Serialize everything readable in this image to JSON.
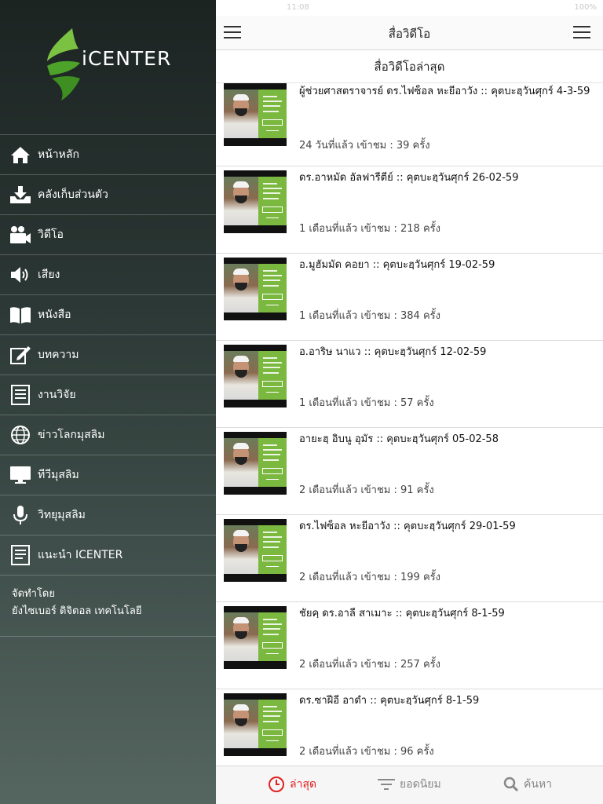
{
  "status": {
    "clock": "11:08",
    "battery": "100%"
  },
  "sidebar": {
    "logo_text": "iCENTER",
    "items": [
      {
        "label": "หน้าหลัก",
        "icon": "home-icon"
      },
      {
        "label": "คลังเก็บส่วนตัว",
        "icon": "download-tray-icon"
      },
      {
        "label": "วิดีโอ",
        "icon": "video-camera-icon"
      },
      {
        "label": "เสียง",
        "icon": "speaker-icon"
      },
      {
        "label": "หนังสือ",
        "icon": "book-icon"
      },
      {
        "label": "บทความ",
        "icon": "edit-note-icon"
      },
      {
        "label": "งานวิจัย",
        "icon": "document-list-icon"
      },
      {
        "label": "ข่าวโลกมุสลิม",
        "icon": "globe-icon"
      },
      {
        "label": "ทีวีมุสลิม",
        "icon": "monitor-icon"
      },
      {
        "label": "วิทยุมุสลิม",
        "icon": "microphone-icon"
      },
      {
        "label": "แนะนำ ICENTER",
        "icon": "document-icon"
      }
    ],
    "credit_line1": "จัดทำโดย",
    "credit_line2": "ยังไซเบอร์ ดิจิตอล เทคโนโลยี"
  },
  "nav": {
    "title": "สื่อวิดีโอ"
  },
  "subheader": "สื่อวิดีโอล่าสุด",
  "videos": [
    {
      "title": "ผู้ช่วยศาสตราจารย์ ดร.ไฟซ็อล หะยีอาวัง :: คุตบะฮฺวันศุกร์ 4-3-59",
      "meta": "24 วันที่แล้ว เข้าชม : 39 ครั้ง"
    },
    {
      "title": "ดร.อาหมัด อัลฟารีตีย์ :: คุตบะฮฺวันศุกร์ 26-02-59",
      "meta": "1 เดือนที่แล้ว เข้าชม : 218 ครั้ง"
    },
    {
      "title": "อ.มูฮัมมัด คอยา :: คุตบะฮฺวันศุกร์ 19-02-59",
      "meta": "1 เดือนที่แล้ว เข้าชม : 384 ครั้ง"
    },
    {
      "title": "อ.อาริษ นาแว :: คุตบะฮฺวันศุกร์ 12-02-59",
      "meta": "1 เดือนที่แล้ว เข้าชม : 57 ครั้ง"
    },
    {
      "title": "อายะฮฺ อิบนู อุมัร :: คุตบะฮฺวันศุกร์ 05-02-58",
      "meta": "2 เดือนที่แล้ว เข้าชม : 91 ครั้ง"
    },
    {
      "title": "ดร.ไฟซ็อล หะยีอาวัง :: คุตบะฮฺวันศุกร์ 29-01-59",
      "meta": "2 เดือนที่แล้ว เข้าชม : 199 ครั้ง"
    },
    {
      "title": "ชัยคฺ ดร.อาลี สาเมาะ :: คุตบะฮฺวันศุกร์ 8-1-59",
      "meta": "2 เดือนที่แล้ว เข้าชม : 257 ครั้ง"
    },
    {
      "title": "ดร.ซาฝีอี อาดำ :: คุตบะฮฺวันศุกร์ 8-1-59",
      "meta": "2 เดือนที่แล้ว เข้าชม : 96 ครั้ง"
    }
  ],
  "tabs": {
    "latest": "ล่าสุด",
    "popular": "ยอดนิยม",
    "search": "ค้นหา"
  },
  "colors": {
    "accent": "#e02020",
    "thumb_green": "#7bb83f",
    "logo_green": "#5cb82e"
  }
}
